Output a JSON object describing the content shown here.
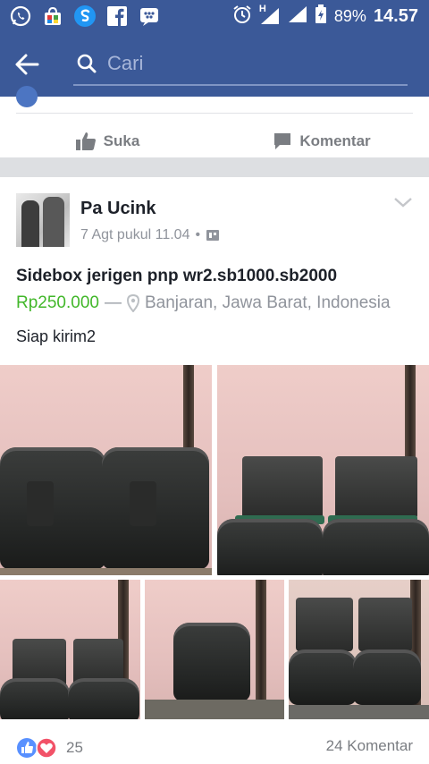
{
  "statusbar": {
    "icons": [
      "whatsapp-icon",
      "store-icon",
      "s-app-icon",
      "facebook-icon",
      "bbm-icon"
    ],
    "battery": "89%",
    "time": "14.57",
    "network": "H"
  },
  "appbar": {
    "search_placeholder": "Cari"
  },
  "prev_post": {
    "like_label": "Suka",
    "comment_label": "Komentar"
  },
  "post": {
    "author": "Pa Ucink",
    "time": "7 Agt pukul 11.04",
    "title": "Sidebox jerigen pnp wr2.sb1000.sb2000",
    "price": "Rp250.000",
    "separator": "—",
    "location": "Banjaran, Jawa Barat, Indonesia",
    "description": "Siap kirim2",
    "reaction_count": "25",
    "comment_count": "24 Komentar"
  },
  "colors": {
    "brand": "#3b5998",
    "price": "#42b72a",
    "muted": "#90949c"
  }
}
